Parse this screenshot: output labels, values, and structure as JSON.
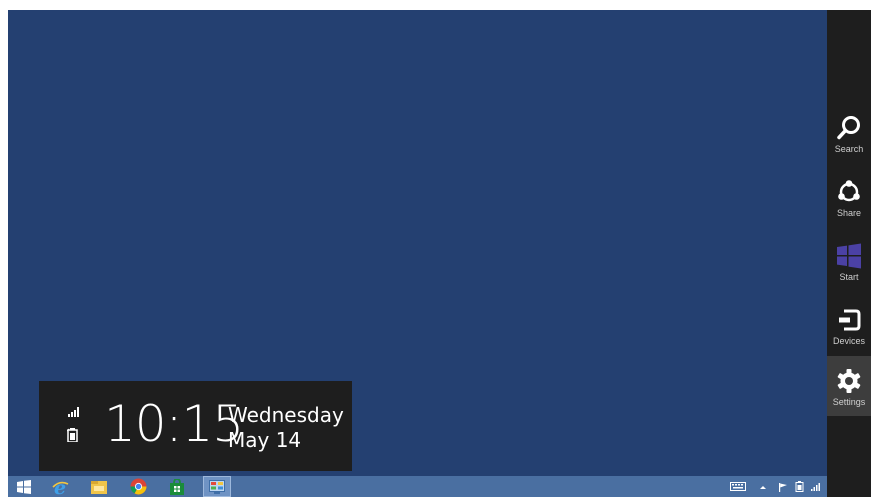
{
  "clock": {
    "time": "10:15",
    "weekday": "Wednesday",
    "date": "May 14",
    "icons": [
      "network-signal-icon",
      "battery-charging-icon"
    ]
  },
  "charms": {
    "items": [
      {
        "label": "Search",
        "icon": "search-icon"
      },
      {
        "label": "Share",
        "icon": "share-icon"
      },
      {
        "label": "Start",
        "icon": "windows-logo-icon"
      },
      {
        "label": "Devices",
        "icon": "devices-icon"
      },
      {
        "label": "Settings",
        "icon": "gear-icon"
      }
    ],
    "selected": "Settings"
  },
  "taskbar": {
    "apps": [
      "start-button",
      "internet-explorer-icon",
      "file-explorer-icon",
      "chrome-icon",
      "store-icon",
      "control-panel-icon"
    ],
    "active_app": "control-panel-icon",
    "tray": [
      "keyboard-icon",
      "show-hidden-icons-arrow",
      "action-center-flag-icon",
      "battery-icon",
      "network-signal-icon"
    ]
  },
  "colors": {
    "desktop": "#244071",
    "charm_bar": "#1e1e1e",
    "taskbar": "#4a6fa1",
    "start_charm_accent": "#4b41a5"
  }
}
